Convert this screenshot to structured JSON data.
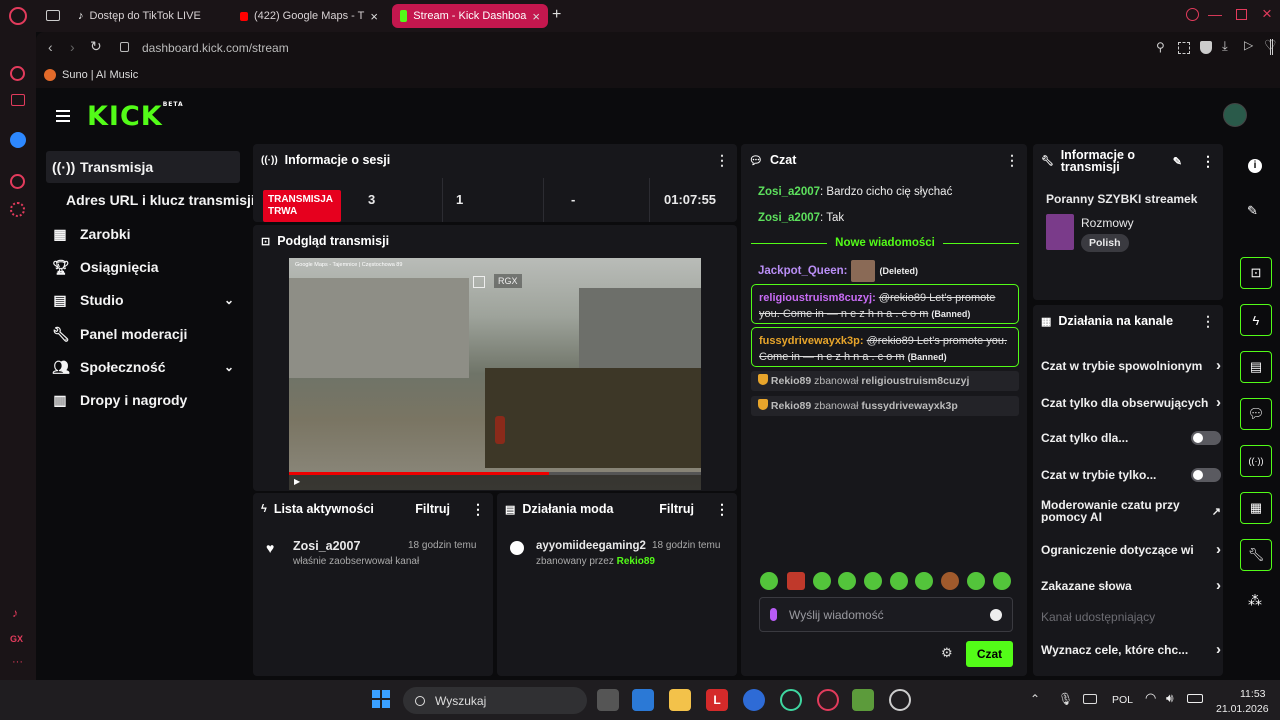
{
  "browser": {
    "tabs": [
      {
        "label": "Dostęp do TikTok LIVE"
      },
      {
        "label": "(422) Google Maps - T"
      },
      {
        "label": "Stream - Kick Dashboa"
      }
    ],
    "url": "dashboard.kick.com/stream",
    "bookmark": "Suno | AI Music"
  },
  "app": {
    "logo": "KICK",
    "beta": "BETA"
  },
  "nav": {
    "items": [
      {
        "label": "Transmisja"
      },
      {
        "label": "Adres URL i klucz transmisji"
      },
      {
        "label": "Zarobki"
      },
      {
        "label": "Osiągnięcia"
      },
      {
        "label": "Studio"
      },
      {
        "label": "Panel moderacji"
      },
      {
        "label": "Społeczność"
      },
      {
        "label": "Dropy i nagrody"
      }
    ]
  },
  "session": {
    "title": "Informacje o sesji",
    "status": "TRANSMISJA TRWA",
    "viewers": "3",
    "followers": "1",
    "subs": "-",
    "time": "01:07:55"
  },
  "preview": {
    "title": "Podgląd transmisji",
    "badge": "RGX",
    "map_label": "Google Maps - Tajemnice | Częstochowa 89"
  },
  "activity": {
    "title": "Lista aktywności",
    "filter": "Filtruj",
    "user": "Zosi_a2007",
    "time": "18 godzin temu",
    "text": "właśnie zaobserwował kanał"
  },
  "modactions": {
    "title": "Działania moda",
    "filter": "Filtruj",
    "user": "ayyomiideegaming2",
    "time": "18 godzin temu",
    "text": "zbanowany przez",
    "by": "Rekio89"
  },
  "chat": {
    "title": "Czat",
    "messages": [
      {
        "user": "Zosi_a2007",
        "text": "Bardzo cicho cię słychać"
      },
      {
        "user": "Zosi_a2007",
        "text": "Tak"
      }
    ],
    "divider": "Nowe wiadomości",
    "jackpot_user": "Jackpot_Queen:",
    "deleted": "(Deleted)",
    "banned1_user": "religioustruism8cuzyj:",
    "banned1_text": "@rekio89 Let's promote you. Come in — n e z h n a . c o m",
    "banned2_user": "fussydrivewayxk3p:",
    "banned2_text": "@rekio89 Let's promote you. Come in — n e z h n a . c o m",
    "banned_tag": "(Banned)",
    "ban1_mod": "Rekio89",
    "ban1_verb": "zbanował",
    "ban1_target": "religioustruism8cuzyj",
    "ban2_mod": "Rekio89",
    "ban2_verb": "zbanował",
    "ban2_target": "fussydrivewayxk3p",
    "placeholder": "Wyślij wiadomość",
    "send": "Czat"
  },
  "streaminfo": {
    "title": "Informacje o transmisji",
    "stream_title": "Poranny SZYBKI streamek",
    "category": "Rozmowy",
    "language": "Polish"
  },
  "channel_actions": {
    "title": "Działania na kanale",
    "items": [
      {
        "label": "Czat w trybie spowolnionym"
      },
      {
        "label": "Czat tylko dla obserwujących"
      },
      {
        "label": "Czat tylko dla..."
      },
      {
        "label": "Czat w trybie tylko..."
      },
      {
        "label": "Moderowanie czatu przy pomocy AI"
      },
      {
        "label": "Ograniczenie dotyczące wi"
      },
      {
        "label": "Zakazane słowa"
      },
      {
        "label": "Kanał udostępniający"
      },
      {
        "label": "Wyznacz cele, które chc..."
      }
    ]
  },
  "taskbar": {
    "search": "Wyszukaj",
    "lang": "POL",
    "time": "11:53",
    "date": "21.01.2026"
  },
  "colors": {
    "accent": "#53fc18",
    "live": "#e6001e",
    "opera": "#c4174e"
  }
}
